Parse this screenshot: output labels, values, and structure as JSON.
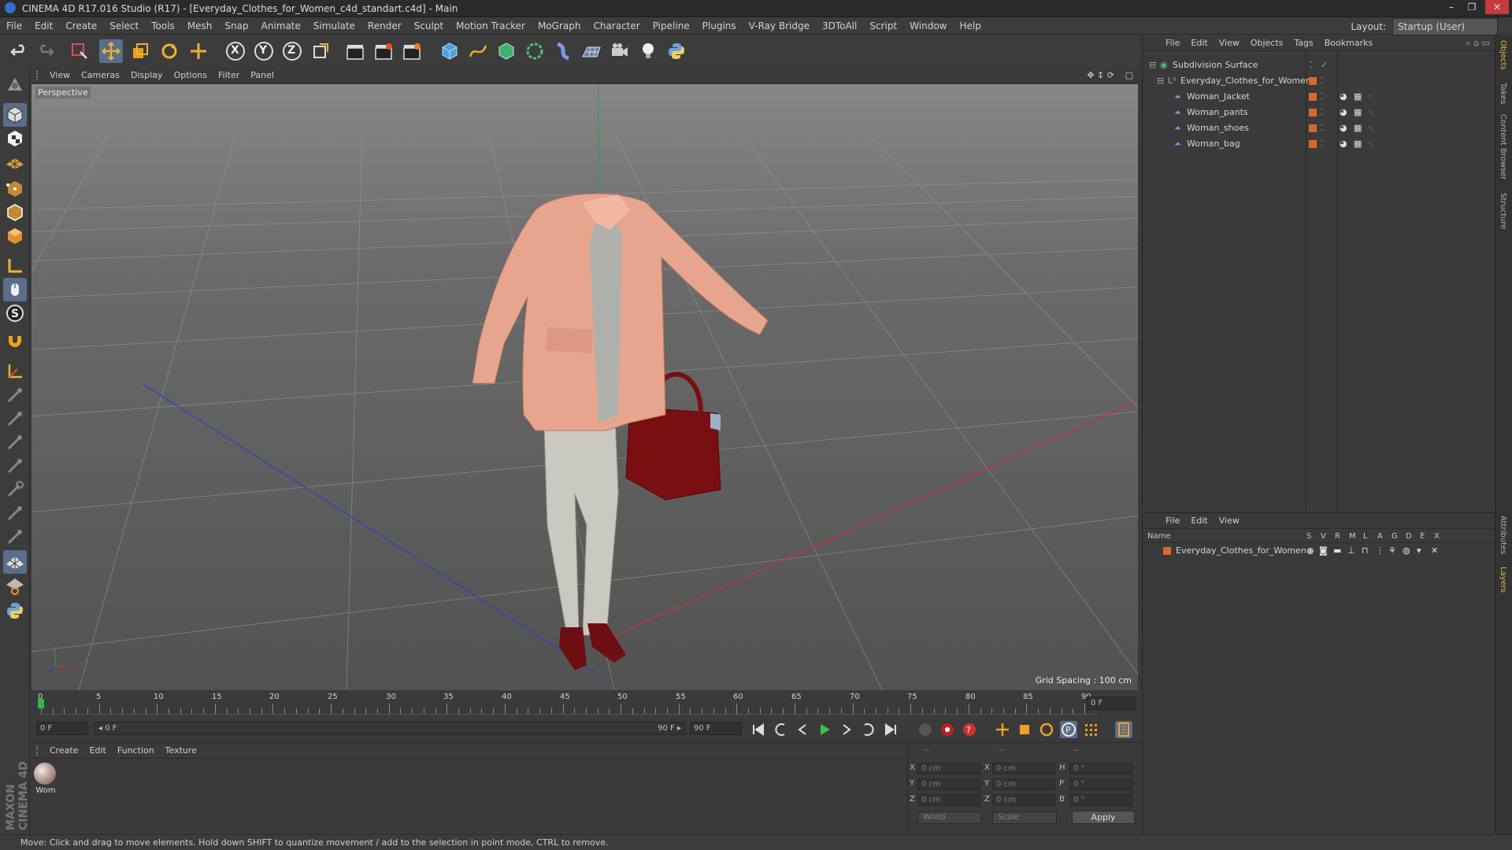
{
  "window": {
    "title": "CINEMA 4D R17.016 Studio (R17) - [Everyday_Clothes_for_Women_c4d_standart.c4d] - Main",
    "controls": [
      "–",
      "❐",
      "✕"
    ]
  },
  "menubar": {
    "items": [
      "File",
      "Edit",
      "Create",
      "Select",
      "Tools",
      "Mesh",
      "Snap",
      "Animate",
      "Simulate",
      "Render",
      "Sculpt",
      "Motion Tracker",
      "MoGraph",
      "Character",
      "Pipeline",
      "Plugins",
      "V-Ray Bridge",
      "3DToAll",
      "Script",
      "Window",
      "Help"
    ],
    "layout_label": "Layout:",
    "layout_value": "Startup (User)"
  },
  "toolbar": {
    "axis_x": "X",
    "axis_y": "Y",
    "axis_z": "Z"
  },
  "viewport": {
    "menu": [
      "View",
      "Cameras",
      "Display",
      "Options",
      "Filter",
      "Panel"
    ],
    "label": "Perspective",
    "grid_spacing": "Grid Spacing : 100 cm"
  },
  "timeline": {
    "ticks": [
      "0",
      "5",
      "10",
      "15",
      "20",
      "25",
      "30",
      "35",
      "40",
      "45",
      "50",
      "55",
      "60",
      "65",
      "70",
      "75",
      "80",
      "85",
      "90"
    ],
    "current_frame": "0 F",
    "start_field": "0 F",
    "range_start": "◂ 0 F",
    "range_end": "90 F ▸",
    "end_field": "90 F"
  },
  "materials": {
    "menu": [
      "Create",
      "Edit",
      "Function",
      "Texture"
    ],
    "items": [
      {
        "label": "Wom"
      }
    ]
  },
  "coordinates": {
    "headers": [
      "--",
      "--",
      "--"
    ],
    "rows": [
      {
        "a": "X",
        "av": "0 cm",
        "b": "X",
        "bv": "0 cm",
        "c": "H",
        "cv": "0 °"
      },
      {
        "a": "Y",
        "av": "0 cm",
        "b": "Y",
        "bv": "0 cm",
        "c": "P",
        "cv": "0 °"
      },
      {
        "a": "Z",
        "av": "0 cm",
        "b": "Z",
        "bv": "0 cm",
        "c": "B",
        "cv": "0 °"
      }
    ],
    "mode": "World",
    "transform": "Scale",
    "apply": "Apply"
  },
  "objects_panel": {
    "menu": [
      "File",
      "Edit",
      "View",
      "Objects",
      "Tags",
      "Bookmarks"
    ],
    "tree": [
      {
        "name": "Subdivision Surface"
      },
      {
        "name": "Everyday_Clothes_for_Women"
      },
      {
        "name": "Woman_Jacket"
      },
      {
        "name": "Woman_pants"
      },
      {
        "name": "Woman_shoes"
      },
      {
        "name": "Woman_bag"
      }
    ]
  },
  "layers_panel": {
    "menu": [
      "File",
      "Edit",
      "View"
    ],
    "header_name": "Name",
    "header_flags": [
      "S",
      "V",
      "R",
      "M",
      "L",
      "A",
      "G",
      "D",
      "E",
      "X"
    ],
    "layer_name": "Everyday_Clothes_for_Women"
  },
  "right_tabs": [
    "Objects",
    "Takes",
    "Content Browser",
    "Structure",
    "Attributes",
    "Layers"
  ],
  "status": "Move: Click and drag to move elements. Hold down SHIFT to quantize movement / add to the selection in point mode, CTRL to remove.",
  "brand": "MAXON CINEMA 4D",
  "colors": {
    "accent": "#5a6e8c",
    "layer_color": "#d9692a",
    "jacket": "#e8a58e",
    "bag": "#7a0f12",
    "pants": "#c9c9c2"
  }
}
